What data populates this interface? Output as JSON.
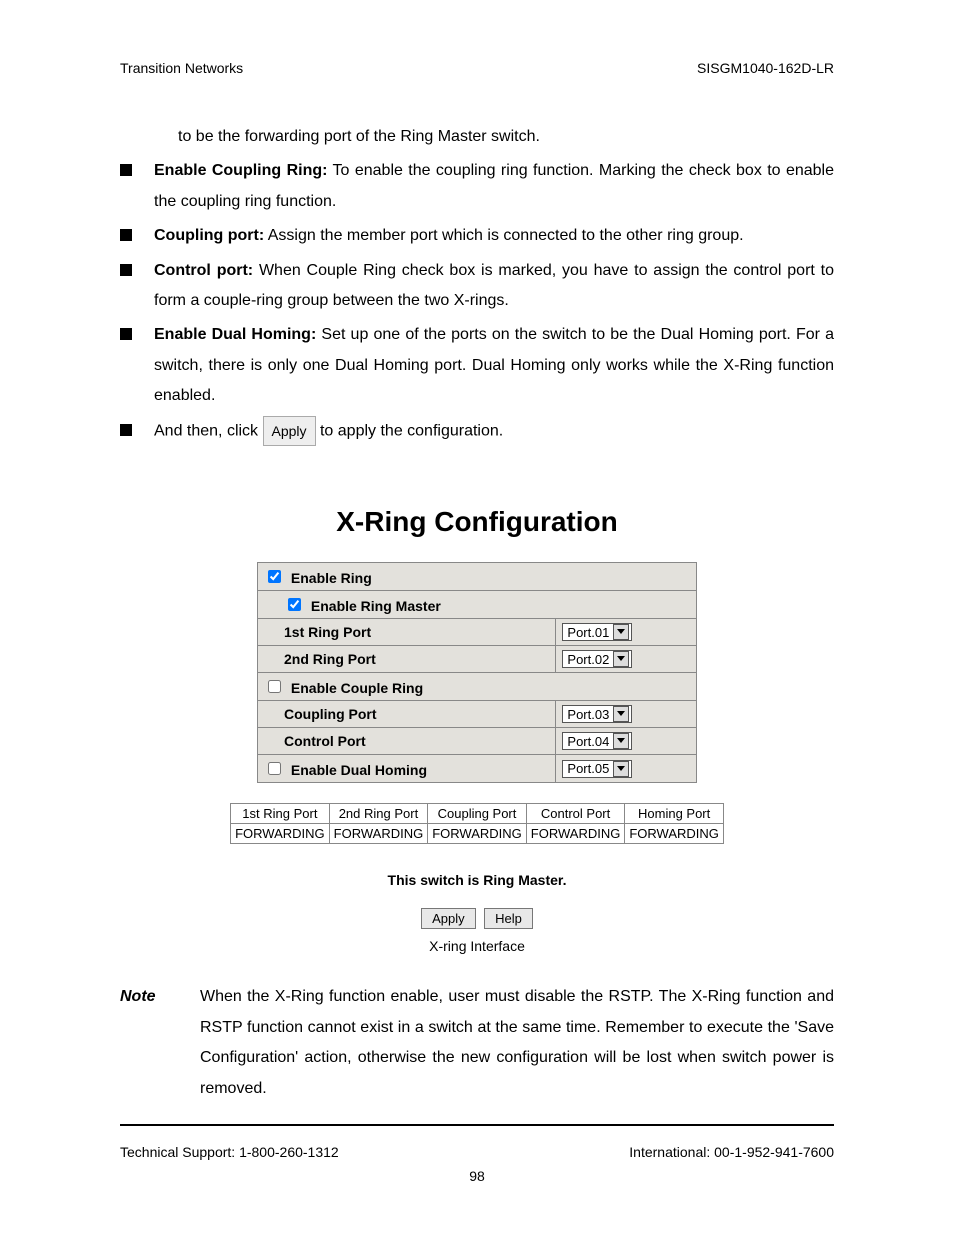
{
  "header": {
    "left": "Transition Networks",
    "right": "SISGM1040-162D-LR"
  },
  "lead_sentence": "to be the forwarding port of the Ring Master switch.",
  "bullets": [
    {
      "label": "Enable Coupling Ring:",
      "text": " To enable the coupling ring function. Marking the check box to enable the coupling ring function."
    },
    {
      "label": "Coupling port:",
      "text": " Assign the member port which is connected to the other ring group."
    },
    {
      "label": "Control port:",
      "text": " When Couple Ring check box is marked, you have to assign the control port to form a couple-ring group between the two X-rings."
    },
    {
      "label": "Enable Dual Homing:",
      "text": " Set up one of the ports on the switch to be the Dual Homing port. For a switch, there is only one Dual Homing port. Dual Homing only works while the X-Ring function enabled."
    }
  ],
  "apply_bullet": {
    "before": "And then, click ",
    "chip": "Apply",
    "after": " to apply the configuration."
  },
  "figure": {
    "title": "X-Ring Configuration",
    "enable_ring": "Enable Ring",
    "enable_ring_master": "Enable Ring Master",
    "row_1st": "1st Ring Port",
    "row_2nd": "2nd Ring Port",
    "enable_couple": "Enable Couple Ring",
    "row_coupling": "Coupling Port",
    "row_control": "Control Port",
    "enable_dual": "Enable Dual Homing",
    "ports": {
      "p1": "Port.01",
      "p2": "Port.02",
      "p3": "Port.03",
      "p4": "Port.04",
      "p5": "Port.05"
    },
    "status_headers": [
      "1st Ring Port",
      "2nd Ring Port",
      "Coupling Port",
      "Control Port",
      "Homing Port"
    ],
    "status_values": [
      "FORWARDING",
      "FORWARDING",
      "FORWARDING",
      "FORWARDING",
      "FORWARDING"
    ],
    "master_note": "This switch is Ring Master.",
    "btn_apply": "Apply",
    "btn_help": "Help",
    "caption": "X-ring Interface"
  },
  "note": {
    "label": "Note",
    "body": "When the X-Ring function enable, user must disable the RSTP. The X-Ring function and RSTP function cannot exist in a switch at the same time. Remember to execute the 'Save Configuration' action, otherwise the new configuration will be lost when switch power is removed."
  },
  "footer": {
    "left": "Technical Support: 1-800-260-1312",
    "right": "International: 00-1-952-941-7600",
    "page": "98"
  }
}
